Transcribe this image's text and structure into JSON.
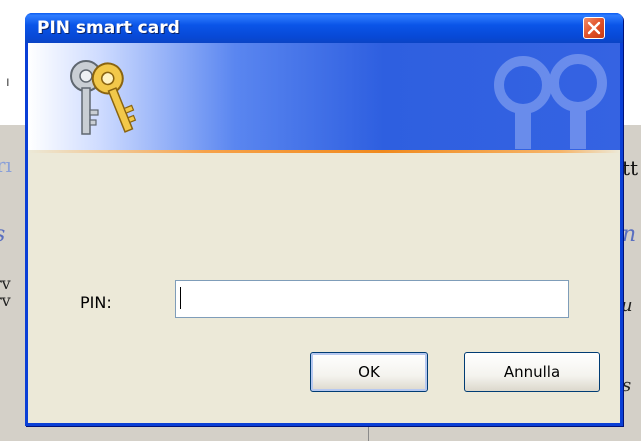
{
  "background": {
    "fragments": {
      "left_mark": "ı",
      "left_1": "rı",
      "left_2": "s",
      "left_3a": "rv",
      "left_3b": "rv",
      "right_1": "tt",
      "right_2": "n",
      "right_3": "u",
      "right_4": "s"
    }
  },
  "dialog": {
    "title": "PIN smart card",
    "close_icon": "close-x-icon",
    "banner_icon": "keys-icon",
    "pin_label": "PIN:",
    "pin_value": "",
    "ok_label": "OK",
    "cancel_label": "Annulla"
  },
  "colors": {
    "titlebar": "#0a55e8",
    "dialog_body": "#ece9d8",
    "close_button": "#e2522a",
    "banner_accent": "#f08a1e"
  }
}
